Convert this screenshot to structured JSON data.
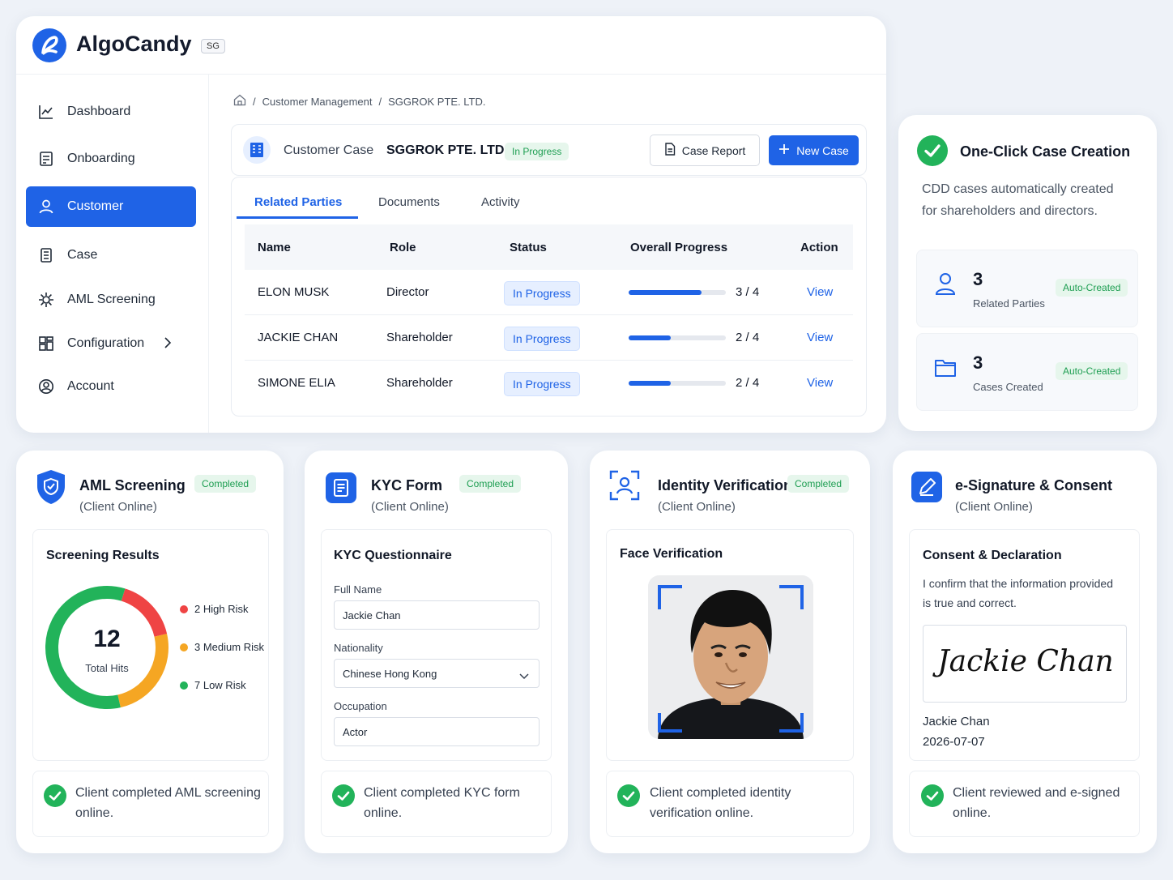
{
  "app": {
    "brand": "AlgoCandy",
    "region": "SG"
  },
  "sidebar": {
    "items": [
      {
        "label": "Dashboard",
        "icon": "chart-line-icon"
      },
      {
        "label": "Onboarding",
        "icon": "clipboard-icon"
      },
      {
        "label": "Customer",
        "icon": "user-icon",
        "active": true
      },
      {
        "label": "Case",
        "icon": "document-icon"
      },
      {
        "label": "AML Screening",
        "icon": "virus-icon"
      },
      {
        "label": "Configuration",
        "icon": "grid-icon"
      },
      {
        "label": "Account",
        "icon": "user-circle-icon"
      }
    ]
  },
  "breadcrumb": {
    "sep": "/",
    "items": [
      "Customer Management",
      "SGGROK PTE. LTD."
    ]
  },
  "case": {
    "label": "Customer Case",
    "company": "SGGROK PTE. LTD.",
    "status": "In Progress",
    "report_btn": "Case Report",
    "new_btn": "New Case"
  },
  "tabs": [
    "Related Parties",
    "Documents",
    "Activity"
  ],
  "table": {
    "headers": [
      "Name",
      "Role",
      "Status",
      "Overall Progress",
      "Action"
    ],
    "rows": [
      {
        "name": "ELON MUSK",
        "role": "Director",
        "status": "In Progress",
        "progress": 0.75,
        "progress_text": "3 / 4",
        "action": "View"
      },
      {
        "name": "JACKIE CHAN",
        "role": "Shareholder",
        "status": "In Progress",
        "progress": 0.43,
        "progress_text": "2 / 4",
        "action": "View"
      },
      {
        "name": "SIMONE ELIA",
        "role": "Shareholder",
        "status": "In Progress",
        "progress": 0.43,
        "progress_text": "2 / 4",
        "action": "View"
      }
    ]
  },
  "oneclick": {
    "title": "One-Click Case Creation",
    "desc1": "CDD cases automatically created",
    "desc2": "for shareholders and directors.",
    "stats": [
      {
        "value": "3",
        "label": "Related Parties",
        "badge": "Auto-Created"
      },
      {
        "value": "3",
        "label": "Cases Created",
        "badge": "Auto-Created"
      }
    ]
  },
  "aml": {
    "title": "AML Screening",
    "sub": "(Client Online)",
    "badge": "Completed",
    "panel_title": "Screening Results",
    "total": "12",
    "total_label": "Total Hits",
    "legend": [
      "2 High Risk",
      "3 Medium Risk",
      "7 Low Risk"
    ],
    "chart_data": {
      "type": "pie",
      "categories": [
        "High Risk",
        "Medium Risk",
        "Low Risk"
      ],
      "values": [
        2,
        3,
        7
      ]
    },
    "done_line1": "Client completed AML screening",
    "done_line2": "online."
  },
  "kyc": {
    "title": "KYC Form",
    "sub": "(Client Online)",
    "badge": "Completed",
    "panel_title": "KYC Questionnaire",
    "fields": [
      {
        "label": "Full Name",
        "value": "Jackie Chan"
      },
      {
        "label": "Nationality",
        "value": "Chinese Hong Kong"
      },
      {
        "label": "Occupation",
        "value": "Actor"
      }
    ],
    "done_line1": "Client completed KYC form",
    "done_line2": "online."
  },
  "idv": {
    "title": "Identity Verification",
    "sub": "(Client Online)",
    "badge": "Completed",
    "panel_title": "Face Verification",
    "done_line1": "Client completed identity",
    "done_line2": "verification online."
  },
  "esign": {
    "title": "e-Signature & Consent",
    "sub": "(Client Online)",
    "panel_title": "Consent & Declaration",
    "text1": "I confirm that the information provided",
    "text2": "is true and correct.",
    "signature": "Jackie Chan",
    "signer": "Jackie Chan",
    "date": "2026-07-07",
    "done_line1": "Client reviewed and e-signed",
    "done_line2": "online."
  },
  "colors": {
    "primary": "#1f63e6",
    "success": "#22b35a",
    "high": "#ef4444",
    "medium": "#f5a623",
    "low": "#22b35a"
  }
}
